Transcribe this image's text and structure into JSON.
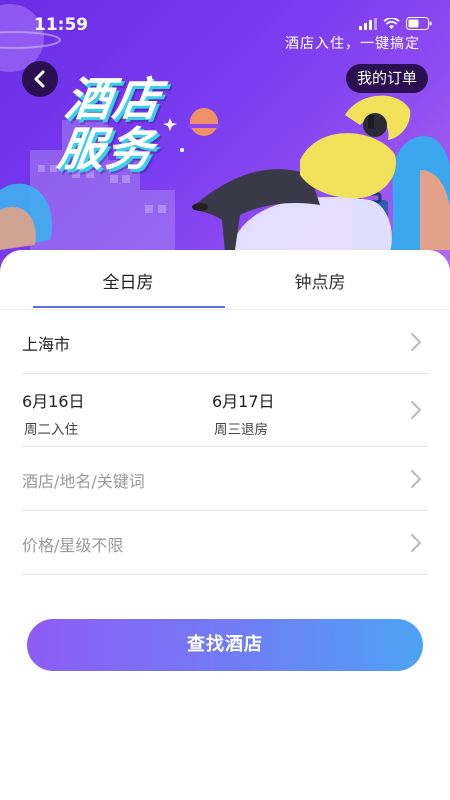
{
  "status_bar": {
    "time": "11:59"
  },
  "header": {
    "slogan": "酒店入住，一键搞定",
    "orders_label": "我的订单",
    "title": "酒店服务"
  },
  "tabs": [
    {
      "label": "全日房",
      "selected": true
    },
    {
      "label": "钟点房",
      "selected": false
    }
  ],
  "form": {
    "city": "上海市",
    "check_in": {
      "date": "6月16日",
      "weekday_label": "周二入住"
    },
    "check_out": {
      "date": "6月17日",
      "weekday_label": "周三退房"
    },
    "keyword_placeholder": "酒店/地名/关键词",
    "price_placeholder": "价格/星级不限"
  },
  "search_button": {
    "label": "查找酒店"
  },
  "colors": {
    "hero_gradient_start": "#6a2ce6",
    "hero_gradient_end": "#b36ee8",
    "tab_underline": "#5a6fe0",
    "button_gradient_start": "#8f5cf6",
    "button_gradient_end": "#4da3f4",
    "placeholder_text": "#9a9a9a"
  },
  "icons": [
    "back-icon",
    "chevron-right-icon",
    "signal-icon",
    "wifi-icon",
    "battery-icon"
  ]
}
